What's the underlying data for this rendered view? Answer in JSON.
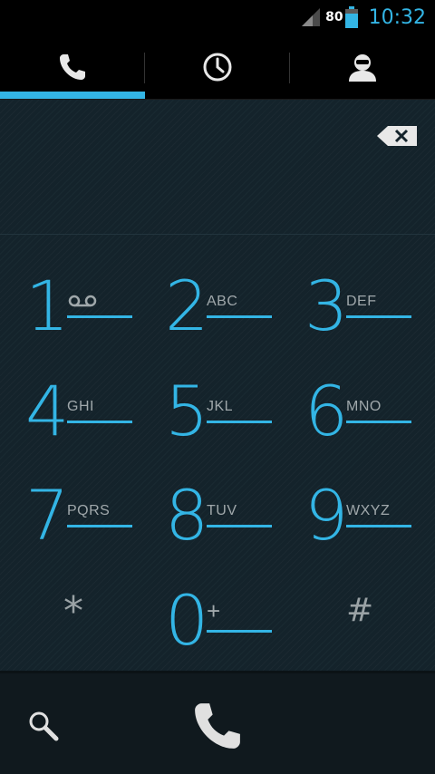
{
  "status_bar": {
    "battery_percent": "80",
    "time": "10:32",
    "icons": [
      "signal-icon",
      "battery-icon"
    ]
  },
  "tabs": [
    {
      "name": "phone",
      "icon": "phone-icon",
      "selected": true
    },
    {
      "name": "recent",
      "icon": "clock-icon",
      "selected": false
    },
    {
      "name": "contacts",
      "icon": "person-icon",
      "selected": false
    }
  ],
  "colors": {
    "accent": "#33b5e5",
    "background": "#14232b",
    "letters": "#a0a8ab"
  },
  "dialer": {
    "input": "",
    "backspace_icon": "backspace-icon",
    "keys": [
      {
        "digit": "1",
        "letters": "",
        "icon": "voicemail-icon"
      },
      {
        "digit": "2",
        "letters": "ABC"
      },
      {
        "digit": "3",
        "letters": "DEF"
      },
      {
        "digit": "4",
        "letters": "GHI"
      },
      {
        "digit": "5",
        "letters": "JKL"
      },
      {
        "digit": "6",
        "letters": "MNO"
      },
      {
        "digit": "7",
        "letters": "PQRS"
      },
      {
        "digit": "8",
        "letters": "TUV"
      },
      {
        "digit": "9",
        "letters": "WXYZ"
      },
      {
        "digit": "*",
        "letters": ""
      },
      {
        "digit": "0",
        "letters": "+"
      },
      {
        "digit": "#",
        "letters": ""
      }
    ]
  },
  "bottom_bar": {
    "search_icon": "search-icon",
    "call_icon": "call-icon"
  }
}
